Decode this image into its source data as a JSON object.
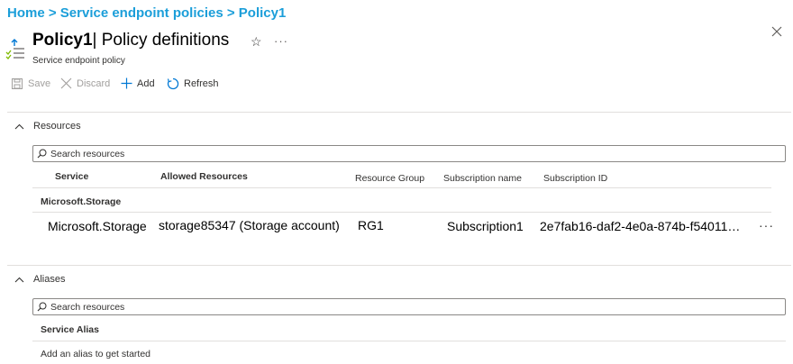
{
  "breadcrumb": {
    "items": [
      "Home",
      "Service endpoint policies",
      "Policy1"
    ],
    "separator": ">"
  },
  "header": {
    "title_bold": "Policy1",
    "title_rest": "| Policy definitions",
    "subtitle": "Service endpoint policy",
    "star_icon": "star-icon",
    "more_label": "···"
  },
  "toolbar": {
    "save_label": "Save",
    "discard_label": "Discard",
    "add_label": "Add",
    "refresh_label": "Refresh"
  },
  "resources": {
    "section_label": "Resources",
    "search_placeholder": "Search resources",
    "columns": [
      "Service",
      "Allowed Resources",
      "Resource Group",
      "Subscription name",
      "Subscription ID"
    ],
    "group_label": "Microsoft.Storage",
    "rows": [
      {
        "service": "Microsoft.Storage",
        "allowed": "storage85347 (Storage account)",
        "group": "RG1",
        "subscription_name": "Subscription1",
        "subscription_id": "2e7fab16-daf2-4e0a-874b-f54011…",
        "more": "···"
      }
    ]
  },
  "aliases": {
    "section_label": "Aliases",
    "search_placeholder": "Search resources",
    "column": "Service Alias",
    "empty_text": "Add an alias to get started"
  },
  "colors": {
    "breadcrumb": "#1b9ed9",
    "accent": "#0078d4",
    "border": "#e1dfdd"
  }
}
